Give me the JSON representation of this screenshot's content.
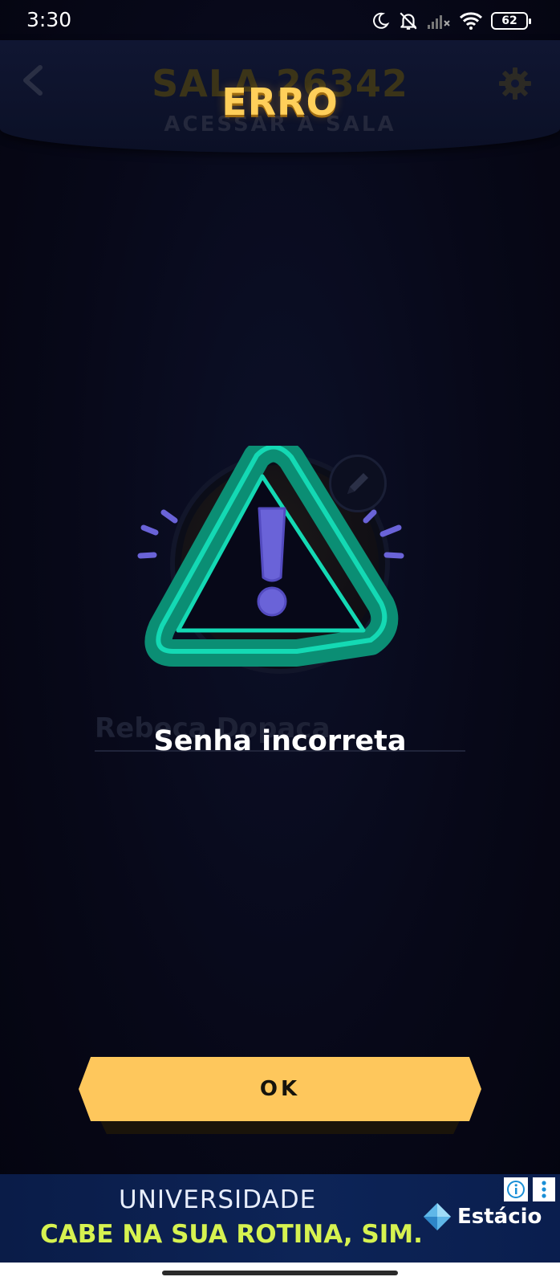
{
  "status_bar": {
    "time": "3:30",
    "battery": "62",
    "icons": [
      "moon-icon",
      "bell-off-icon",
      "signal-off-icon",
      "wifi-icon",
      "battery-icon"
    ]
  },
  "room": {
    "title": "SALA 26342",
    "subtitle": "ACESSAR A SALA",
    "player_name": "Rebeca Dopaca",
    "icons": [
      "back-arrow-icon",
      "gear-icon",
      "pencil-icon"
    ]
  },
  "dialog": {
    "title": "ERRO",
    "message": "Senha incorreta",
    "ok_label": "OK",
    "icon": "warning-triangle-icon"
  },
  "ad": {
    "line1": "UNIVERSIDADE",
    "line2": "CABE NA SUA ROTINA, SIM.",
    "brand": "Estácio",
    "icons": [
      "info-icon",
      "more-vertical-icon"
    ]
  },
  "colors": {
    "accent_yellow": "#fec75c",
    "title_yellow": "#ffcf5a",
    "warning_teal": "#14d9b4",
    "warning_purple": "#6a63d8",
    "background": "#06061a"
  }
}
